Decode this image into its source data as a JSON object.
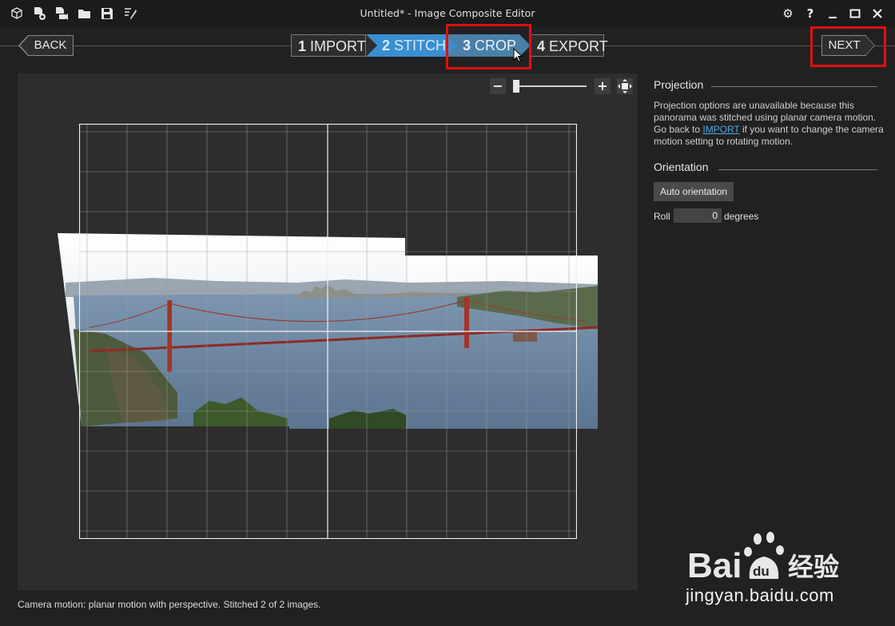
{
  "window": {
    "title": "Untitled* - Image Composite Editor",
    "toolbar_icons": [
      "new-project-icon",
      "new-from-images-icon",
      "new-from-video-icon",
      "open-icon",
      "save-icon",
      "export-icon"
    ]
  },
  "nav": {
    "back_label": "BACK",
    "next_label": "NEXT",
    "steps": [
      {
        "num": "1",
        "label": "IMPORT",
        "state": "done"
      },
      {
        "num": "2",
        "label": "STITCH",
        "state": "done"
      },
      {
        "num": "3",
        "label": "CROP",
        "state": "active"
      },
      {
        "num": "4",
        "label": "EXPORT",
        "state": "pending"
      }
    ]
  },
  "zoom": {
    "minus": "−",
    "plus": "+",
    "level": 0.03
  },
  "panel": {
    "projection_heading": "Projection",
    "projection_text_before": "Projection options are unavailable because this panorama was stitched using planar camera motion. Go back to ",
    "projection_link": "IMPORT",
    "projection_text_after": " if you want to change the camera motion setting to rotating motion.",
    "orientation_heading": "Orientation",
    "auto_orientation_label": "Auto orientation",
    "roll_label": "Roll",
    "roll_value": "0",
    "roll_unit": "degrees"
  },
  "status": "Camera motion: planar motion with perspective. Stitched 2 of 2 images.",
  "colors": {
    "accent_blue": "#4ea8e6",
    "step_done": "#3a8fd0",
    "step_active": "#4a7fa8",
    "highlight_red": "#e01010"
  },
  "watermark": {
    "logo": "Baidu经验",
    "url": "jingyan.baidu.com"
  }
}
